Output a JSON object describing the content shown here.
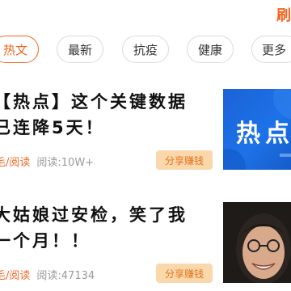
{
  "header": {
    "refresh_label": "刷"
  },
  "tabs": [
    {
      "label": "热文",
      "active": true
    },
    {
      "label": "最新",
      "active": false
    },
    {
      "label": "抗疫",
      "active": false
    },
    {
      "label": "健康",
      "active": false
    },
    {
      "label": "更多",
      "active": false
    }
  ],
  "articles": [
    {
      "title": "【热点】这个关键数据\n已连降5天！",
      "source": "毛/阅读",
      "reads": "阅读:10W+",
      "share_label": "分享赚钱",
      "thumb_text": "热点"
    },
    {
      "title": "大姑娘过安检，笑了我\n一个月！！",
      "source": "毛/阅读",
      "reads": "阅读:47134",
      "share_label": "分享赚钱"
    }
  ],
  "colors": {
    "accent": "#f5641e",
    "share_bg": "#fbd8ac",
    "thumb_blue": "#1d6fe3"
  }
}
